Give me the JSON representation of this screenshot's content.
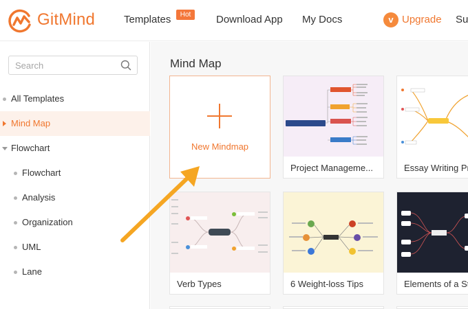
{
  "header": {
    "brand": "GitMind",
    "nav": [
      {
        "label": "Templates",
        "badge": "Hot"
      },
      {
        "label": "Download App"
      },
      {
        "label": "My Docs"
      }
    ],
    "upgrade_label": "Upgrade",
    "support_label": "Sup"
  },
  "sidebar": {
    "search_placeholder": "Search",
    "items": [
      {
        "label": "All Templates"
      },
      {
        "label": "Mind Map",
        "active": true
      },
      {
        "label": "Flowchart",
        "expanded": true
      },
      {
        "label": "Flowchart"
      },
      {
        "label": "Analysis"
      },
      {
        "label": "Organization"
      },
      {
        "label": "UML"
      },
      {
        "label": "Lane"
      }
    ]
  },
  "main": {
    "section_title": "Mind Map",
    "new_card_label": "New Mindmap",
    "cards": [
      {
        "title": "Project Manageme..."
      },
      {
        "title": "Essay Writing Pr"
      },
      {
        "title": "Verb Types"
      },
      {
        "title": "6 Weight-loss Tips"
      },
      {
        "title": "Elements of a St"
      }
    ]
  },
  "colors": {
    "accent": "#f0772f",
    "annotation_arrow": "#f5a623"
  },
  "icons": [
    "gitmind-logo-icon",
    "upgrade-icon",
    "search-icon",
    "plus-icon",
    "annotation-arrow"
  ]
}
